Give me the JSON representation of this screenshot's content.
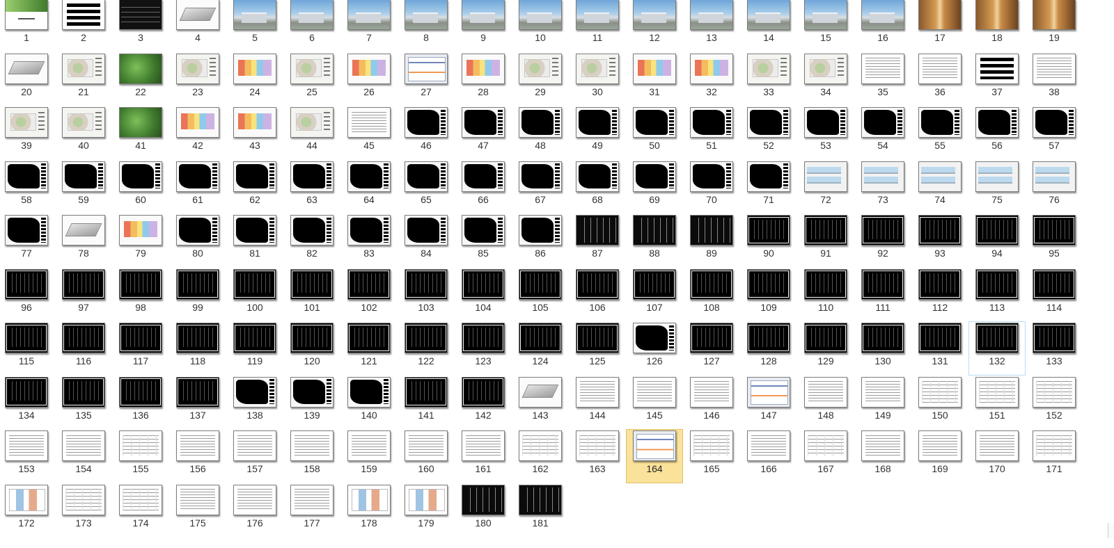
{
  "window": {
    "view": "slide-sorter thumbnails"
  },
  "colors": {
    "selected_bg": "#fbe29a",
    "hover_border": "#bcdcf4",
    "label_text": "#333333"
  },
  "selected_slide": "164",
  "hover_slide": "132",
  "slides": [
    {
      "label": "1",
      "kind": "title"
    },
    {
      "label": "2",
      "kind": "boxes"
    },
    {
      "label": "3",
      "kind": "dark"
    },
    {
      "label": "4",
      "kind": "white3d"
    },
    {
      "label": "5",
      "kind": "sky"
    },
    {
      "label": "6",
      "kind": "sky"
    },
    {
      "label": "7",
      "kind": "sky"
    },
    {
      "label": "8",
      "kind": "sky"
    },
    {
      "label": "9",
      "kind": "sky"
    },
    {
      "label": "10",
      "kind": "sky"
    },
    {
      "label": "11",
      "kind": "sky"
    },
    {
      "label": "12",
      "kind": "sky"
    },
    {
      "label": "13",
      "kind": "sky"
    },
    {
      "label": "14",
      "kind": "sky"
    },
    {
      "label": "15",
      "kind": "sky"
    },
    {
      "label": "16",
      "kind": "sky"
    },
    {
      "label": "17",
      "kind": "interior"
    },
    {
      "label": "18",
      "kind": "interior"
    },
    {
      "label": "19",
      "kind": "interior"
    },
    {
      "label": "20",
      "kind": "white3d"
    },
    {
      "label": "21",
      "kind": "plan"
    },
    {
      "label": "22",
      "kind": "green"
    },
    {
      "label": "23",
      "kind": "plan"
    },
    {
      "label": "24",
      "kind": "color"
    },
    {
      "label": "25",
      "kind": "plan"
    },
    {
      "label": "26",
      "kind": "color"
    },
    {
      "label": "27",
      "kind": "screen"
    },
    {
      "label": "28",
      "kind": "color"
    },
    {
      "label": "29",
      "kind": "plan"
    },
    {
      "label": "30",
      "kind": "plan"
    },
    {
      "label": "31",
      "kind": "color"
    },
    {
      "label": "32",
      "kind": "color"
    },
    {
      "label": "33",
      "kind": "plan"
    },
    {
      "label": "34",
      "kind": "plan"
    },
    {
      "label": "35",
      "kind": "doc"
    },
    {
      "label": "36",
      "kind": "doc"
    },
    {
      "label": "37",
      "kind": "boxes"
    },
    {
      "label": "38",
      "kind": "doc"
    },
    {
      "label": "39",
      "kind": "plan"
    },
    {
      "label": "40",
      "kind": "plan"
    },
    {
      "label": "41",
      "kind": "green"
    },
    {
      "label": "42",
      "kind": "color"
    },
    {
      "label": "43",
      "kind": "color"
    },
    {
      "label": "44",
      "kind": "plan"
    },
    {
      "label": "45",
      "kind": "doc"
    },
    {
      "label": "46",
      "kind": "cad"
    },
    {
      "label": "47",
      "kind": "cad"
    },
    {
      "label": "48",
      "kind": "cad"
    },
    {
      "label": "49",
      "kind": "cad"
    },
    {
      "label": "50",
      "kind": "cad"
    },
    {
      "label": "51",
      "kind": "cad"
    },
    {
      "label": "52",
      "kind": "cad"
    },
    {
      "label": "53",
      "kind": "cad"
    },
    {
      "label": "54",
      "kind": "cad"
    },
    {
      "label": "55",
      "kind": "cad"
    },
    {
      "label": "56",
      "kind": "cad"
    },
    {
      "label": "57",
      "kind": "cad"
    },
    {
      "label": "58",
      "kind": "cad"
    },
    {
      "label": "59",
      "kind": "cad"
    },
    {
      "label": "60",
      "kind": "cad"
    },
    {
      "label": "61",
      "kind": "cad"
    },
    {
      "label": "62",
      "kind": "cad"
    },
    {
      "label": "63",
      "kind": "cad"
    },
    {
      "label": "64",
      "kind": "cad"
    },
    {
      "label": "65",
      "kind": "cad"
    },
    {
      "label": "66",
      "kind": "cad"
    },
    {
      "label": "67",
      "kind": "cad"
    },
    {
      "label": "68",
      "kind": "cad"
    },
    {
      "label": "69",
      "kind": "cad"
    },
    {
      "label": "70",
      "kind": "cad"
    },
    {
      "label": "71",
      "kind": "cad"
    },
    {
      "label": "72",
      "kind": "elev"
    },
    {
      "label": "73",
      "kind": "elev"
    },
    {
      "label": "74",
      "kind": "elev"
    },
    {
      "label": "75",
      "kind": "elev"
    },
    {
      "label": "76",
      "kind": "elev"
    },
    {
      "label": "77",
      "kind": "cad"
    },
    {
      "label": "78",
      "kind": "white3d"
    },
    {
      "label": "79",
      "kind": "color"
    },
    {
      "label": "80",
      "kind": "cad"
    },
    {
      "label": "81",
      "kind": "cad"
    },
    {
      "label": "82",
      "kind": "cad"
    },
    {
      "label": "83",
      "kind": "cad"
    },
    {
      "label": "84",
      "kind": "cad"
    },
    {
      "label": "85",
      "kind": "cad"
    },
    {
      "label": "86",
      "kind": "cad"
    },
    {
      "label": "87",
      "kind": "black"
    },
    {
      "label": "88",
      "kind": "black"
    },
    {
      "label": "89",
      "kind": "black"
    },
    {
      "label": "90",
      "kind": "cadw"
    },
    {
      "label": "91",
      "kind": "cadw"
    },
    {
      "label": "92",
      "kind": "cadw"
    },
    {
      "label": "93",
      "kind": "cadw"
    },
    {
      "label": "94",
      "kind": "cadw"
    },
    {
      "label": "95",
      "kind": "cadw"
    },
    {
      "label": "96",
      "kind": "cadw"
    },
    {
      "label": "97",
      "kind": "cadw"
    },
    {
      "label": "98",
      "kind": "cadw"
    },
    {
      "label": "99",
      "kind": "cadw"
    },
    {
      "label": "100",
      "kind": "cadw"
    },
    {
      "label": "101",
      "kind": "cadw"
    },
    {
      "label": "102",
      "kind": "cadw"
    },
    {
      "label": "103",
      "kind": "cadw"
    },
    {
      "label": "104",
      "kind": "cadw"
    },
    {
      "label": "105",
      "kind": "cadw"
    },
    {
      "label": "106",
      "kind": "cadw"
    },
    {
      "label": "107",
      "kind": "cadw"
    },
    {
      "label": "108",
      "kind": "cadw"
    },
    {
      "label": "109",
      "kind": "cadw"
    },
    {
      "label": "110",
      "kind": "cadw"
    },
    {
      "label": "111",
      "kind": "cadw"
    },
    {
      "label": "112",
      "kind": "cadw"
    },
    {
      "label": "113",
      "kind": "cadw"
    },
    {
      "label": "114",
      "kind": "cadw"
    },
    {
      "label": "115",
      "kind": "cadw"
    },
    {
      "label": "116",
      "kind": "cadw"
    },
    {
      "label": "117",
      "kind": "cadw"
    },
    {
      "label": "118",
      "kind": "cadw"
    },
    {
      "label": "119",
      "kind": "cadw"
    },
    {
      "label": "120",
      "kind": "cadw"
    },
    {
      "label": "121",
      "kind": "cadw"
    },
    {
      "label": "122",
      "kind": "cadw"
    },
    {
      "label": "123",
      "kind": "cadw"
    },
    {
      "label": "124",
      "kind": "cadw"
    },
    {
      "label": "125",
      "kind": "cadw"
    },
    {
      "label": "126",
      "kind": "cad"
    },
    {
      "label": "127",
      "kind": "cadw"
    },
    {
      "label": "128",
      "kind": "cadw"
    },
    {
      "label": "129",
      "kind": "cadw"
    },
    {
      "label": "130",
      "kind": "cadw"
    },
    {
      "label": "131",
      "kind": "cadw"
    },
    {
      "label": "132",
      "kind": "cadw"
    },
    {
      "label": "133",
      "kind": "cadw"
    },
    {
      "label": "134",
      "kind": "cadw"
    },
    {
      "label": "135",
      "kind": "cadw"
    },
    {
      "label": "136",
      "kind": "cadw"
    },
    {
      "label": "137",
      "kind": "cadw"
    },
    {
      "label": "138",
      "kind": "cad"
    },
    {
      "label": "139",
      "kind": "cad"
    },
    {
      "label": "140",
      "kind": "cad"
    },
    {
      "label": "141",
      "kind": "cadw"
    },
    {
      "label": "142",
      "kind": "cadw"
    },
    {
      "label": "143",
      "kind": "white3d"
    },
    {
      "label": "144",
      "kind": "doc"
    },
    {
      "label": "145",
      "kind": "doc"
    },
    {
      "label": "146",
      "kind": "doc"
    },
    {
      "label": "147",
      "kind": "screen"
    },
    {
      "label": "148",
      "kind": "doc"
    },
    {
      "label": "149",
      "kind": "doc"
    },
    {
      "label": "150",
      "kind": "table"
    },
    {
      "label": "151",
      "kind": "table"
    },
    {
      "label": "152",
      "kind": "table"
    },
    {
      "label": "153",
      "kind": "doc"
    },
    {
      "label": "154",
      "kind": "doc"
    },
    {
      "label": "155",
      "kind": "table"
    },
    {
      "label": "156",
      "kind": "doc"
    },
    {
      "label": "157",
      "kind": "doc"
    },
    {
      "label": "158",
      "kind": "doc"
    },
    {
      "label": "159",
      "kind": "doc"
    },
    {
      "label": "160",
      "kind": "doc"
    },
    {
      "label": "161",
      "kind": "doc"
    },
    {
      "label": "162",
      "kind": "table"
    },
    {
      "label": "163",
      "kind": "table"
    },
    {
      "label": "164",
      "kind": "screen"
    },
    {
      "label": "165",
      "kind": "table"
    },
    {
      "label": "166",
      "kind": "doc"
    },
    {
      "label": "167",
      "kind": "table"
    },
    {
      "label": "168",
      "kind": "doc"
    },
    {
      "label": "169",
      "kind": "doc"
    },
    {
      "label": "170",
      "kind": "doc"
    },
    {
      "label": "171",
      "kind": "table"
    },
    {
      "label": "172",
      "kind": "chart"
    },
    {
      "label": "173",
      "kind": "table"
    },
    {
      "label": "174",
      "kind": "table"
    },
    {
      "label": "175",
      "kind": "doc"
    },
    {
      "label": "176",
      "kind": "doc"
    },
    {
      "label": "177",
      "kind": "doc"
    },
    {
      "label": "178",
      "kind": "chart"
    },
    {
      "label": "179",
      "kind": "chart"
    },
    {
      "label": "180",
      "kind": "black"
    },
    {
      "label": "181",
      "kind": "black"
    }
  ]
}
